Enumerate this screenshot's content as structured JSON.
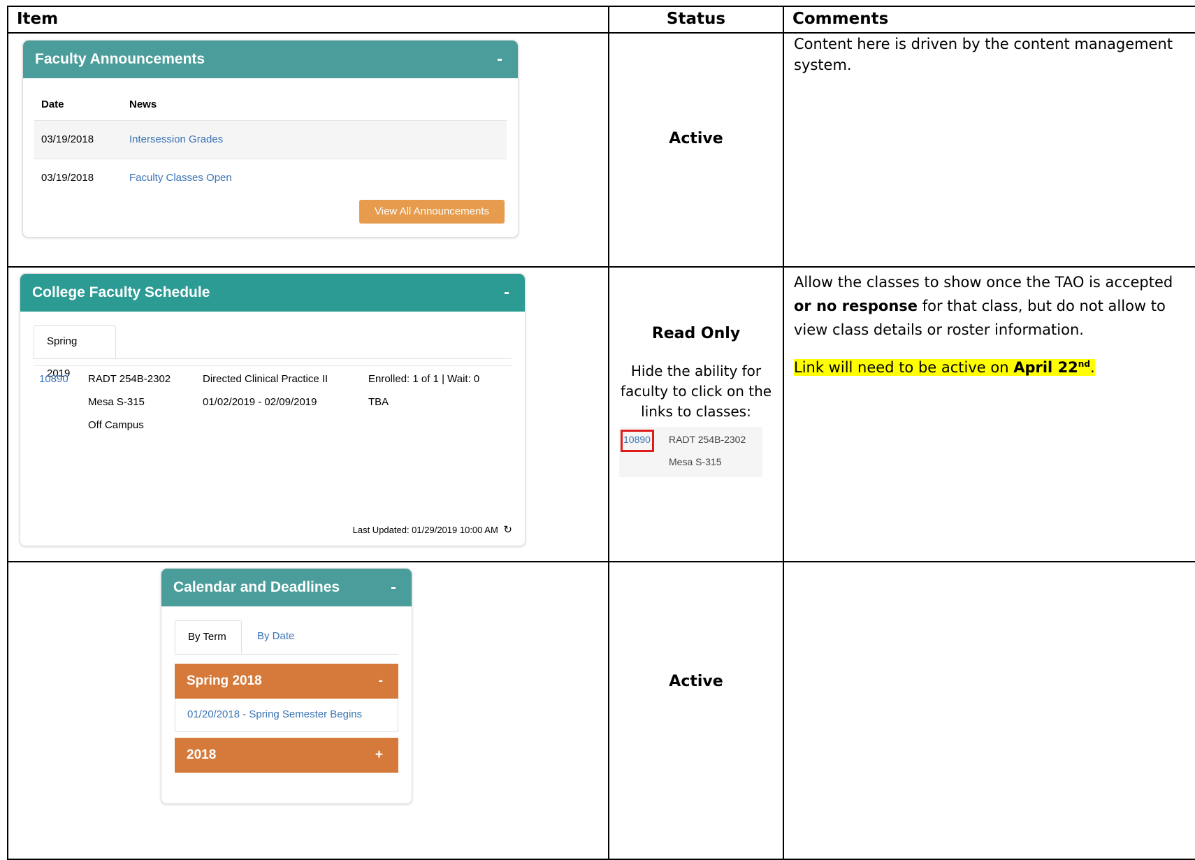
{
  "headers": {
    "item": "Item",
    "status": "Status",
    "comments": "Comments"
  },
  "rows": [
    {
      "status": "Active",
      "comment": "Content here is driven by the content management system.",
      "widget": {
        "title": "Faculty Announcements",
        "collapse": "-",
        "col_date": "Date",
        "col_news": "News",
        "items": [
          {
            "date": "03/19/2018",
            "news": "Intersession Grades"
          },
          {
            "date": "03/19/2018",
            "news": "Faculty Classes Open"
          }
        ],
        "button": "View All Announcements"
      }
    },
    {
      "status": "Read Only",
      "status_note": "Hide the ability for faculty to click on the links to classes:",
      "comment_pre": "Allow the classes to show once the TAO is accepted ",
      "comment_bold": "or no response",
      "comment_post": " for that class, but do not allow to view class details or roster information.",
      "highlight_pre": "Link will need to be active on ",
      "highlight_bold": "April 22",
      "highlight_sup": "nd",
      "highlight_post": ".",
      "widget": {
        "title": "College Faculty Schedule",
        "collapse": "-",
        "tab": "Spring 2019",
        "crn": "10890",
        "course": "RADT 254B-2302",
        "course_title": "Directed Clinical Practice II",
        "enrollment": "Enrolled: 1 of 1 | Wait: 0",
        "room": "Mesa S-315",
        "dates": "01/02/2019 - 02/09/2019",
        "time": "TBA",
        "location": "Off Campus",
        "last_updated": "Last Updated: 01/29/2019 10:00 AM"
      },
      "snippet": {
        "crn": "10890",
        "course": "RADT 254B-2302",
        "room": "Mesa S-315"
      }
    },
    {
      "status": "Active",
      "comment": "",
      "widget": {
        "title": "Calendar and Deadlines",
        "collapse": "-",
        "tabs": [
          "By Term",
          "By Date"
        ],
        "groups": [
          {
            "label": "Spring 2018",
            "toggle": "-",
            "entry": "01/20/2018 - Spring Semester Begins"
          },
          {
            "label": "2018",
            "toggle": "+"
          }
        ]
      }
    }
  ],
  "colors": {
    "teal_header": "#4a9d9a",
    "teal_header_2": "#2b9b93",
    "orange_button": "#e79b4c",
    "orange_accordion": "#d57a3a",
    "link": "#3b74b4",
    "highlight": "#ffff00",
    "red_box": "#e01b1b"
  }
}
